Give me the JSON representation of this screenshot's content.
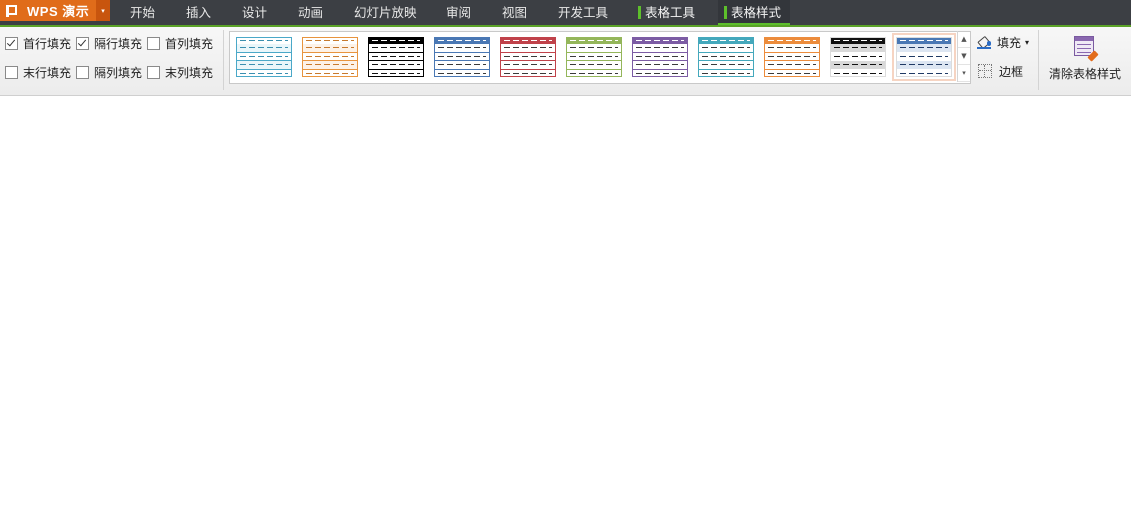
{
  "app": {
    "name": "WPS 演示",
    "dropdown": "▾"
  },
  "tabs": [
    {
      "label": "开始"
    },
    {
      "label": "插入"
    },
    {
      "label": "设计"
    },
    {
      "label": "动画"
    },
    {
      "label": "幻灯片放映"
    },
    {
      "label": "审阅"
    },
    {
      "label": "视图"
    },
    {
      "label": "开发工具"
    },
    {
      "label": "表格工具"
    },
    {
      "label": "表格样式"
    }
  ],
  "options": {
    "first_row": {
      "label": "首行填充",
      "checked": true
    },
    "banded_rows": {
      "label": "隔行填充",
      "checked": true
    },
    "first_col": {
      "label": "首列填充",
      "checked": false
    },
    "last_row": {
      "label": "末行填充",
      "checked": false
    },
    "banded_cols": {
      "label": "隔列填充",
      "checked": false
    },
    "last_col": {
      "label": "末列填充",
      "checked": false
    }
  },
  "styles": [
    {
      "name": "light-cyan",
      "header": "#ffffff",
      "band": "#eaf6fa",
      "border": "#4aa8c8",
      "dash": "#3b8fb0"
    },
    {
      "name": "light-orange",
      "header": "#ffffff",
      "band": "#fdf2e8",
      "border": "#e8943e",
      "dash": "#c87a2e"
    },
    {
      "name": "black",
      "header": "#000000",
      "band": "#ffffff",
      "border": "#000000",
      "dash": "#111111"
    },
    {
      "name": "blue",
      "header": "#4a78b4",
      "band": "#ffffff",
      "border": "#4a78b4",
      "dash": "#3a3a3a"
    },
    {
      "name": "red",
      "header": "#c0424a",
      "band": "#ffffff",
      "border": "#c0424a",
      "dash": "#3a3a3a"
    },
    {
      "name": "green",
      "header": "#94b65a",
      "band": "#ffffff",
      "border": "#94b65a",
      "dash": "#3a3a3a"
    },
    {
      "name": "purple",
      "header": "#7c5ca4",
      "band": "#ffffff",
      "border": "#7c5ca4",
      "dash": "#3a3a3a"
    },
    {
      "name": "teal",
      "header": "#44a8bc",
      "band": "#ffffff",
      "border": "#44a8bc",
      "dash": "#3a3a3a"
    },
    {
      "name": "orange",
      "header": "#ec8c3c",
      "band": "#ffffff",
      "border": "#ec8c3c",
      "dash": "#3a3a3a"
    },
    {
      "name": "gray-black",
      "header": "#111111",
      "band": "#d9d9d9",
      "border": "#ffffff",
      "dash": "#111111"
    },
    {
      "name": "blue-banded",
      "header": "#4a78b4",
      "band": "#dde6f2",
      "border": "#ffffff",
      "dash": "#203a64"
    }
  ],
  "selected_style": 10,
  "fill": {
    "label": "填充",
    "arrow": "▾"
  },
  "border": {
    "label": "边框"
  },
  "clear": {
    "label": "清除表格样式"
  }
}
